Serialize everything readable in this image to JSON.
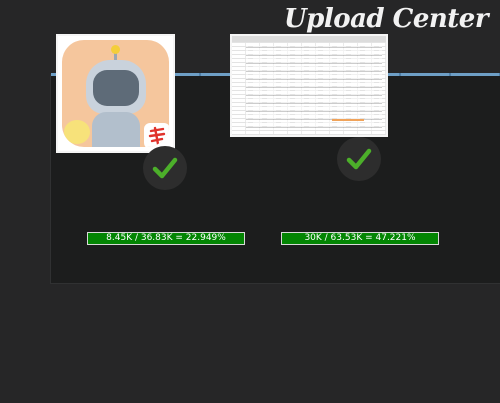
{
  "header": {
    "title": "Upload Center"
  },
  "uploads": [
    {
      "thumbnail": "app-icon",
      "status_icon": "checkmark-icon",
      "progress_text": "8.45K / 36.83K = 22.949%",
      "progress_percent": 22.949
    },
    {
      "thumbnail": "spreadsheet",
      "status_icon": "checkmark-icon",
      "progress_text": "30K / 63.53K = 47.221%",
      "progress_percent": 47.221
    }
  ],
  "colors": {
    "background": "#252526",
    "panel": "#1c1d1d",
    "panel_rule": "#6e9fc6",
    "progress_fill": "#038503",
    "check_green": "#4caf2a"
  }
}
